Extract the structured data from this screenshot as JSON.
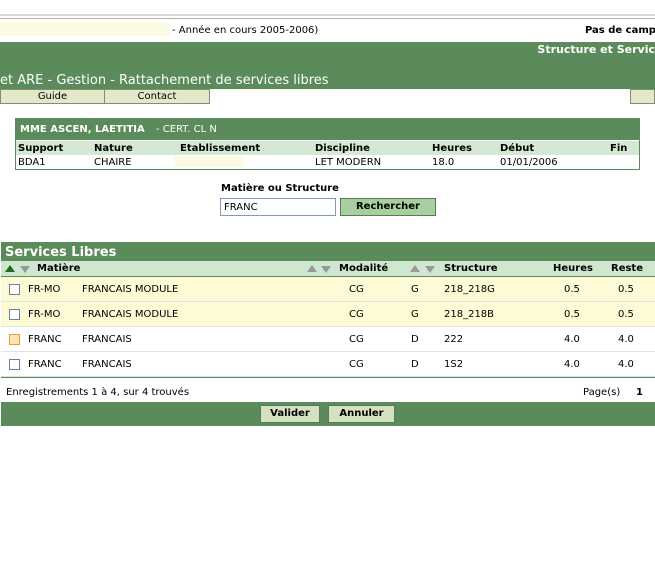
{
  "header": {
    "year_text": "- Année en cours 2005-2006)",
    "right_text": "Pas de camp",
    "section_title": "Structure et Servic",
    "page_title": "et ARE - Gestion - Rattachement de services libres"
  },
  "menu": {
    "guide": "Guide",
    "contact": "Contact"
  },
  "teacher": {
    "name": "MME ASCEN, LAETITIA",
    "grade": "- CERT. CL N",
    "columns": [
      "Support",
      "Nature",
      "Etablissement",
      "Discipline",
      "Heures",
      "Début",
      "Fin"
    ],
    "values": {
      "support": "BDA1",
      "nature": "CHAIRE",
      "etablissement": "",
      "discipline": "LET MODERN",
      "heures": "18.0",
      "debut": "01/01/2006",
      "fin": ""
    }
  },
  "search": {
    "label": "Matière ou Structure",
    "value": "FRANC",
    "button": "Rechercher"
  },
  "services": {
    "title": "Services Libres",
    "columns": {
      "matiere": "Matière",
      "modalite": "Modalité",
      "structure": "Structure",
      "heures": "Heures",
      "reste": "Reste"
    },
    "rows": [
      {
        "code": "FR-MO",
        "label": "FRANCAIS MODULE",
        "modalite": "CG",
        "type": "G",
        "structure": "218_218G",
        "heures": "0.5",
        "reste": "0.5"
      },
      {
        "code": "FR-MO",
        "label": "FRANCAIS MODULE",
        "modalite": "CG",
        "type": "G",
        "structure": "218_218B",
        "heures": "0.5",
        "reste": "0.5"
      },
      {
        "code": "FRANC",
        "label": "FRANCAIS",
        "modalite": "CG",
        "type": "D",
        "structure": "222",
        "heures": "4.0",
        "reste": "4.0"
      },
      {
        "code": "FRANC",
        "label": "FRANCAIS",
        "modalite": "CG",
        "type": "D",
        "structure": "1S2",
        "heures": "4.0",
        "reste": "4.0"
      }
    ],
    "records_text": "Enregistrements 1 à 4, sur 4 trouvés",
    "pages_label": "Page(s)",
    "page_number": "1",
    "validate": "Valider",
    "cancel": "Annuler"
  }
}
